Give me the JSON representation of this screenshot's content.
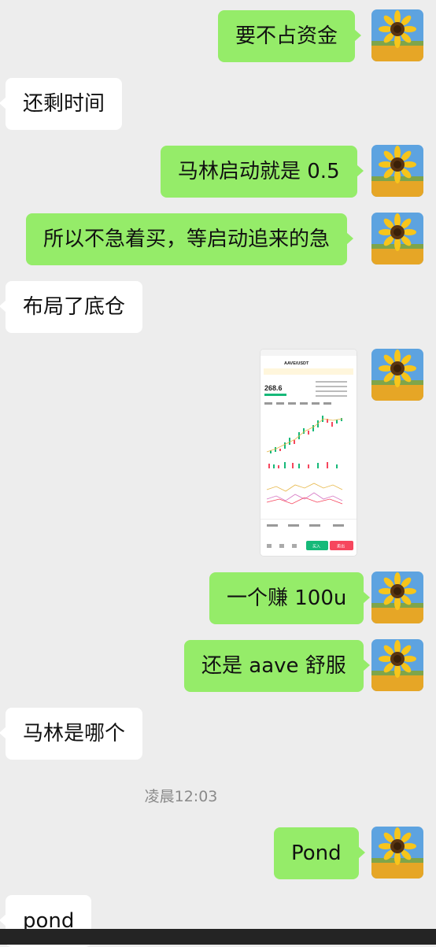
{
  "messages": {
    "m1": "要不占资金",
    "m2": "还剩时间",
    "m3": "马林启动就是 0.5",
    "m4": "所以不急着买，等启动追来的急",
    "m5": "布局了底仓",
    "m7": "一个赚 100u",
    "m8": "还是 aave 舒服",
    "m9": "马林是哪个",
    "m10": "Pond",
    "m11": "pond"
  },
  "timestamp": "凌晨12:03",
  "shared_image": {
    "pair": "AAVE/USDT",
    "price": "268.6",
    "buy_label": "买入",
    "sell_label": "卖出"
  },
  "colors": {
    "chat_background": "#ededed",
    "my_bubble": "#95ec69",
    "their_bubble": "#ffffff",
    "price_up": "#16b979",
    "price_down": "#f6465d"
  },
  "icons": {
    "my_avatar": "sunflower-avatar-icon"
  }
}
